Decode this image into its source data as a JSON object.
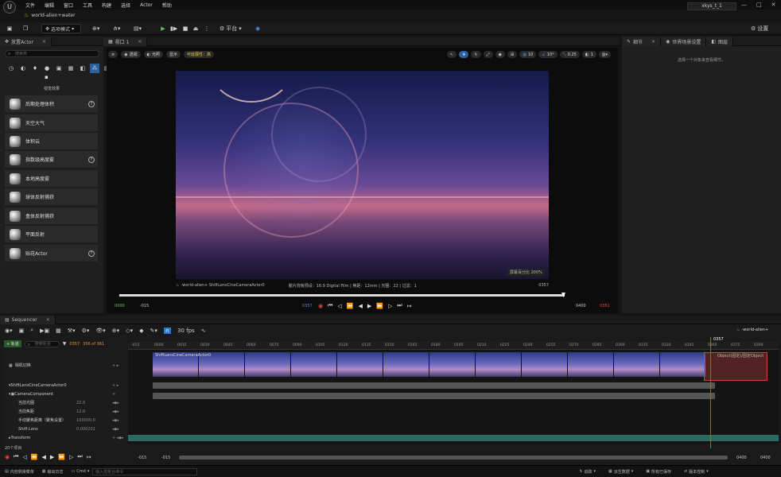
{
  "menubar": {
    "logo": "U",
    "items": [
      "文件",
      "编辑",
      "窗口",
      "工具",
      "构建",
      "选择",
      "Actor",
      "帮助"
    ],
    "project_tab": "world-alien+water",
    "user": "xkys_t_1",
    "minimize": "—",
    "maximize": "□",
    "close": "✕"
  },
  "toolbar": {
    "mode": "选项模式",
    "platform": "平台",
    "settings": "设置"
  },
  "left_panel": {
    "tab": "放置Actor",
    "search_placeholder": "搜索类",
    "category_title": "视觉效果",
    "items": [
      {
        "label": "后期处理体积",
        "help": true
      },
      {
        "label": "天空大气",
        "help": false
      },
      {
        "label": "体积云",
        "help": false
      },
      {
        "label": "指数级高度雾",
        "help": true
      },
      {
        "label": "本地高度雾",
        "help": false
      },
      {
        "label": "球体反射捕获",
        "help": false
      },
      {
        "label": "盒体反射捕获",
        "help": false
      },
      {
        "label": "平面反射",
        "help": false
      },
      {
        "label": "贴花Actor",
        "help": true
      }
    ]
  },
  "viewport": {
    "tab": "视口 1",
    "chip_view": "透视",
    "chip_lit": "光照",
    "chip_show": "显示",
    "chip_scalability": "可延展性：高",
    "grid_value": "10",
    "rot_value": "10°",
    "scale_value": "0.25",
    "cam_value": "1",
    "info_left": "-world-alien+ ShiftLensCineCameraActor0",
    "info_mid": "胶片背板预设：16:9 Digital Film | 焦距：12mm | 光圈：22 | 过滤：1",
    "info_frame": "0357",
    "screen_pct": "屏幕百分比 200%",
    "tc_start": "0000",
    "tc_pre": "-015",
    "tc_current": "0357",
    "tc_end": "0400",
    "tc_post": "0361"
  },
  "right_panel": {
    "tab_details": "细节",
    "tab_outliner": "世界场景设置",
    "tab_layers": "图层",
    "empty_msg": "选择一个对象来查看细节。"
  },
  "sequencer": {
    "tab": "Sequencer",
    "fps": "30 fps",
    "add_track": "+ 轨道",
    "search_placeholder": "搜索轨道",
    "frame": "0357",
    "frame_range": "356 of 361",
    "playhead_label": "0357",
    "seq_name": "-world-alien+",
    "ruler_ticks": [
      "-015",
      "0000",
      "0015",
      "0030",
      "0045",
      "0060",
      "0075",
      "0090",
      "0105",
      "0120",
      "0135",
      "0150",
      "0165",
      "0180",
      "0195",
      "0210",
      "0225",
      "0240",
      "0255",
      "0270",
      "0285",
      "0300",
      "0315",
      "0330",
      "0345",
      "0360",
      "0375",
      "0390"
    ],
    "tracks": [
      {
        "label": "相机切换",
        "value": ""
      },
      {
        "label": "ShiftLensCineCameraActor0",
        "value": ""
      },
      {
        "label": "CameraComponent",
        "value": ""
      },
      {
        "label": "当前光圈",
        "value": "22.0"
      },
      {
        "label": "当前焦距",
        "value": "12.0"
      },
      {
        "label": "手动聚焦距离（聚焦设置）",
        "value": "100000.0"
      },
      {
        "label": "Shift Lens",
        "value": "0.000101"
      },
      {
        "label": "Transform",
        "value": ""
      }
    ],
    "clip_label": "ShiftLensCineCameraActor0",
    "end_label": "Object(固定)/固定Object",
    "item_count": "20个项目",
    "bottom_tc1": "-015",
    "bottom_tc2": "-015",
    "bottom_tc3": "0400",
    "bottom_tc4": "0400"
  },
  "status": {
    "content": "内容侧滑菜单",
    "output": "输出日志",
    "cmd": "Cmd",
    "cmd_placeholder": "输入控制台命令",
    "trace": "追踪",
    "derived": "派生数据",
    "saved": "所有已保存",
    "version": "版本控制"
  }
}
